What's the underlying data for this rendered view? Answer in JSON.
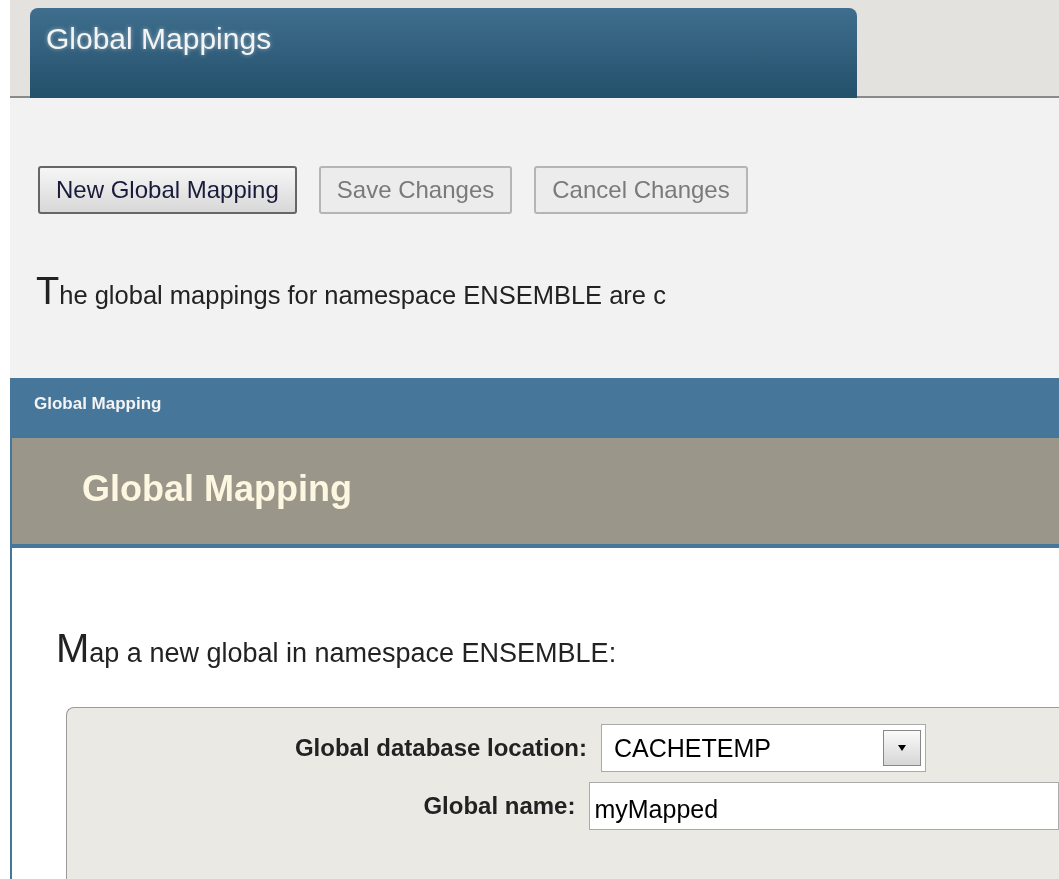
{
  "tab": {
    "label": "Global Mappings",
    "selected": true
  },
  "buttons": [
    {
      "label": "New Global Mapping",
      "disabled": false
    },
    {
      "label": "Save Changes",
      "disabled": true
    },
    {
      "label": "Cancel Changes",
      "disabled": true
    }
  ],
  "intro": "The global mappings for namespace ENSEMBLE are c",
  "dialog": {
    "title": "Global Mapping",
    "heading": "Global Mapping",
    "intro": "Map a new global in namespace ENSEMBLE:",
    "fields": [
      {
        "kind": "select",
        "label": "Global database location:",
        "value": "CACHETEMP"
      },
      {
        "kind": "text",
        "label": "Global name:",
        "value": "myMapped"
      }
    ]
  }
}
